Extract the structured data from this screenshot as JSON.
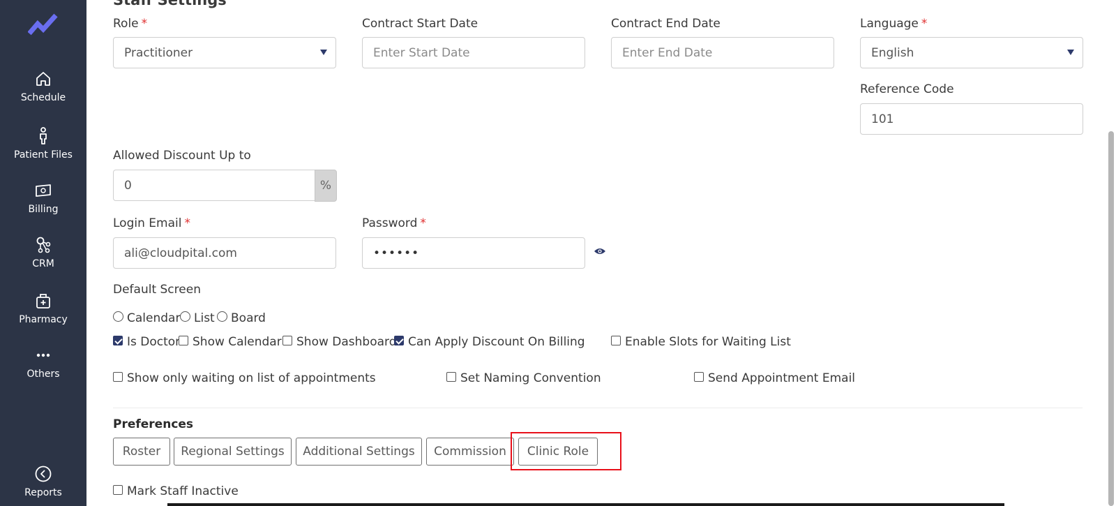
{
  "sidebar": {
    "items": [
      {
        "label": "Schedule",
        "icon": "home-icon"
      },
      {
        "label": "Patient Files",
        "icon": "person-icon"
      },
      {
        "label": "Billing",
        "icon": "money-icon"
      },
      {
        "label": "CRM",
        "icon": "network-icon"
      },
      {
        "label": "Pharmacy",
        "icon": "medkit-icon"
      },
      {
        "label": "Others",
        "icon": "more-dots-icon"
      },
      {
        "label": "Reports",
        "icon": "back-circle-icon"
      }
    ]
  },
  "form": {
    "section_title": "Staff Settings",
    "role": {
      "label": "Role",
      "required": "*",
      "value": "Practitioner"
    },
    "contract_start": {
      "label": "Contract Start Date",
      "placeholder": "Enter Start Date"
    },
    "contract_end": {
      "label": "Contract End Date",
      "placeholder": "Enter End Date"
    },
    "language": {
      "label": "Language",
      "required": "*",
      "value": "English"
    },
    "reference_code": {
      "label": "Reference Code",
      "value": "101"
    },
    "allowed_discount": {
      "label": "Allowed Discount Up to",
      "value": "0",
      "suffix": "%"
    },
    "login_email": {
      "label": "Login Email",
      "required": "*",
      "value": "ali@cloudpital.com"
    },
    "password": {
      "label": "Password",
      "required": "*",
      "value": "••••••"
    },
    "default_screen": {
      "label": "Default Screen",
      "options": [
        "Calendar",
        "List",
        "Board"
      ]
    },
    "checkboxes_row1": [
      {
        "label": "Is Doctor",
        "checked": true
      },
      {
        "label": "Show Calendar",
        "checked": false
      },
      {
        "label": "Show Dashboard",
        "checked": false
      },
      {
        "label": "Can Apply Discount On Billing",
        "checked": true
      },
      {
        "label": "Enable Slots for Waiting List",
        "checked": false
      }
    ],
    "checkboxes_row2": [
      {
        "label": "Show only waiting on list of appointments",
        "checked": false
      },
      {
        "label": "Set Naming Convention",
        "checked": false
      },
      {
        "label": "Send Appointment Email",
        "checked": false
      }
    ],
    "preferences": {
      "title": "Preferences",
      "tabs": [
        "Roster",
        "Regional Settings",
        "Additional Settings",
        "Commission",
        "Clinic Role"
      ]
    },
    "mark_inactive": {
      "label": "Mark Staff Inactive",
      "checked": false
    }
  },
  "colors": {
    "sidebar_bg": "#2c3446",
    "accent": "#2d3a6b",
    "required": "#e03131",
    "highlight": "#e8101a",
    "logo": "#6a6ef0"
  }
}
